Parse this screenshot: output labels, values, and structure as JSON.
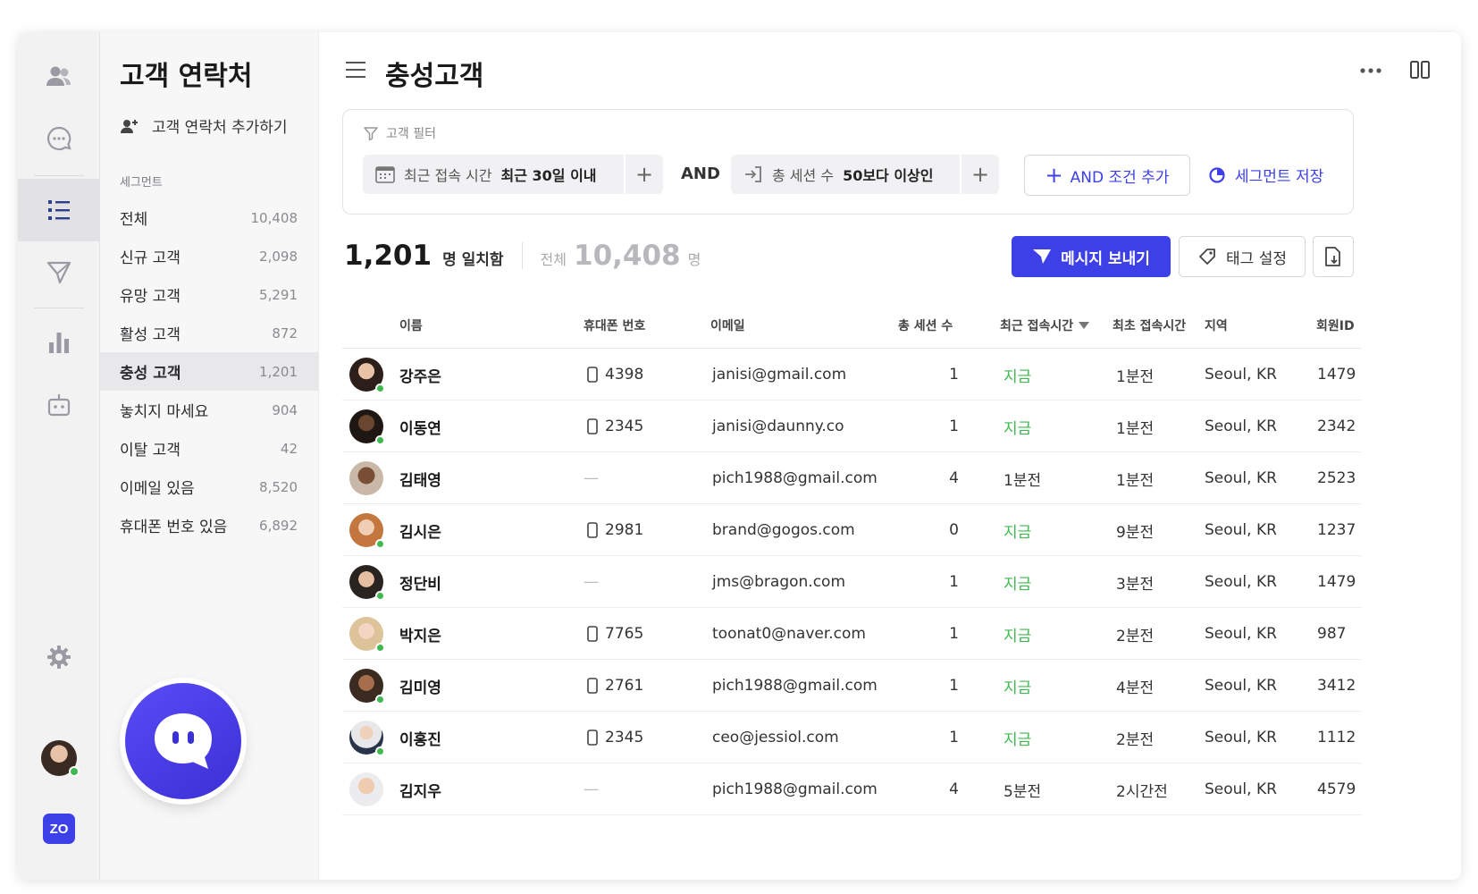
{
  "sidebar": {
    "title": "고객 연락처",
    "add_contact": "고객 연락처 추가하기",
    "segment_heading": "세그먼트",
    "segments": [
      {
        "label": "전체",
        "count": "10,408"
      },
      {
        "label": "신규 고객",
        "count": "2,098"
      },
      {
        "label": "유망 고객",
        "count": "5,291"
      },
      {
        "label": "활성 고객",
        "count": "872"
      },
      {
        "label": "충성 고객",
        "count": "1,201"
      },
      {
        "label": "놓치지 마세요",
        "count": "904"
      },
      {
        "label": "이탈 고객",
        "count": "42"
      },
      {
        "label": "이메일 있음",
        "count": "8,520"
      },
      {
        "label": "휴대폰 번호 있음",
        "count": "6,892"
      }
    ],
    "active_segment_index": 4
  },
  "rail": {
    "icons": [
      "people-icon",
      "chat-icon",
      "list-icon",
      "send-icon",
      "bar-chart-icon",
      "bot-icon",
      "gear-icon"
    ],
    "brand_badge": "ZO"
  },
  "header": {
    "title": "충성고객"
  },
  "filter": {
    "label": "고객 필터",
    "condition1": {
      "field": "최근 접속 시간",
      "value": "최근 30일 이내"
    },
    "and_text": "AND",
    "condition2": {
      "field": "총 세션 수",
      "value": "50보다 이상인"
    },
    "add_condition": "AND 조건 추가",
    "save_segment": "세그먼트 저장"
  },
  "summary": {
    "matched_count": "1,201",
    "matched_label": "명 일치함",
    "total_label": "전체",
    "total_count": "10,408",
    "total_unit": "명"
  },
  "actions": {
    "send_message": "메시지 보내기",
    "tag_settings": "태그 설정"
  },
  "table": {
    "columns": [
      "이름",
      "휴대폰 번호",
      "이메일",
      "총 세션 수",
      "최근 접속시간",
      "최초 접속시간",
      "지역",
      "회원ID"
    ],
    "rows": [
      {
        "name": "강주은",
        "phone": "4398",
        "email": "janisi@gmail.com",
        "sessions": "1",
        "recent": "지금",
        "first": "1분전",
        "region": "Seoul, KR",
        "id": "1479",
        "online": true
      },
      {
        "name": "이동연",
        "phone": "2345",
        "email": "janisi@daunny.co",
        "sessions": "1",
        "recent": "지금",
        "first": "1분전",
        "region": "Seoul, KR",
        "id": "2342",
        "online": true
      },
      {
        "name": "김태영",
        "phone": "",
        "email": "pich1988@gmail.com",
        "sessions": "4",
        "recent": "1분전",
        "first": "1분전",
        "region": "Seoul, KR",
        "id": "2523",
        "online": false
      },
      {
        "name": "김시은",
        "phone": "2981",
        "email": "brand@gogos.com",
        "sessions": "0",
        "recent": "지금",
        "first": "9분전",
        "region": "Seoul, KR",
        "id": "1237",
        "online": true
      },
      {
        "name": "정단비",
        "phone": "",
        "email": "jms@bragon.com",
        "sessions": "1",
        "recent": "지금",
        "first": "3분전",
        "region": "Seoul, KR",
        "id": "1479",
        "online": true
      },
      {
        "name": "박지은",
        "phone": "7765",
        "email": "toonat0@naver.com",
        "sessions": "1",
        "recent": "지금",
        "first": "2분전",
        "region": "Seoul, KR",
        "id": "987",
        "online": true
      },
      {
        "name": "김미영",
        "phone": "2761",
        "email": "pich1988@gmail.com",
        "sessions": "1",
        "recent": "지금",
        "first": "4분전",
        "region": "Seoul, KR",
        "id": "3412",
        "online": true
      },
      {
        "name": "이홍진",
        "phone": "2345",
        "email": "ceo@jessiol.com",
        "sessions": "1",
        "recent": "지금",
        "first": "2분전",
        "region": "Seoul, KR",
        "id": "1112",
        "online": true
      },
      {
        "name": "김지우",
        "phone": "",
        "email": "pich1988@gmail.com",
        "sessions": "4",
        "recent": "5분전",
        "first": "2시간전",
        "region": "Seoul, KR",
        "id": "4579",
        "online": false
      }
    ]
  },
  "colors": {
    "accent": "#3d40e6",
    "online": "#3fb950",
    "now_text": "#3fb950"
  }
}
